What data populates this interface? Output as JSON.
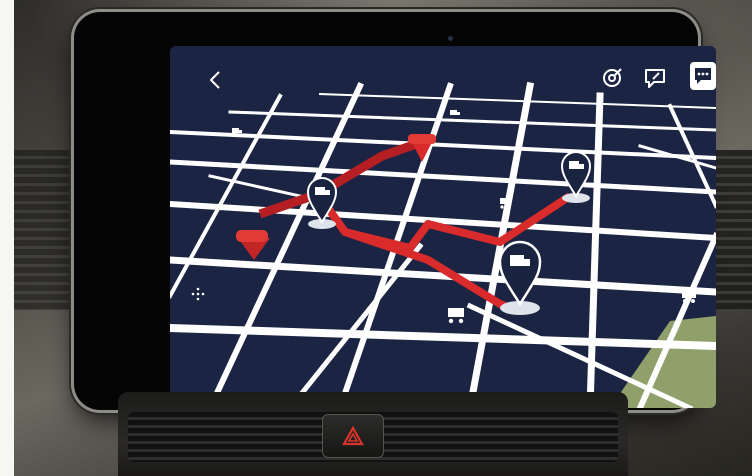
{
  "screen": {
    "icons": {
      "back": "chevron-left-icon",
      "target": "target-icon",
      "feedback": "feedback-icon",
      "chat": "chat-bubble-icon",
      "dpad": "dpad-icon"
    },
    "colors": {
      "map_background": "#1a2340",
      "roads": "#ffffff",
      "route": "#d92b2b",
      "park": "#8fa06a",
      "pins": "#1a2340"
    },
    "map_markers": [
      {
        "kind": "delivery-truck",
        "icon": "truck-pin-icon"
      },
      {
        "kind": "delivery-truck",
        "icon": "truck-pin-icon"
      },
      {
        "kind": "delivery-truck",
        "icon": "truck-pin-icon"
      },
      {
        "kind": "red-destination-pin",
        "icon": "red-pin-icon"
      },
      {
        "kind": "red-destination-pin",
        "icon": "red-pin-icon"
      },
      {
        "kind": "shopping-cart",
        "icon": "cart-icon"
      },
      {
        "kind": "shopping-cart",
        "icon": "cart-icon"
      },
      {
        "kind": "shopping-cart",
        "icon": "cart-icon"
      }
    ]
  },
  "car": {
    "hazard_icon": "hazard-triangle-icon",
    "hazard_color": "#d9342b"
  }
}
